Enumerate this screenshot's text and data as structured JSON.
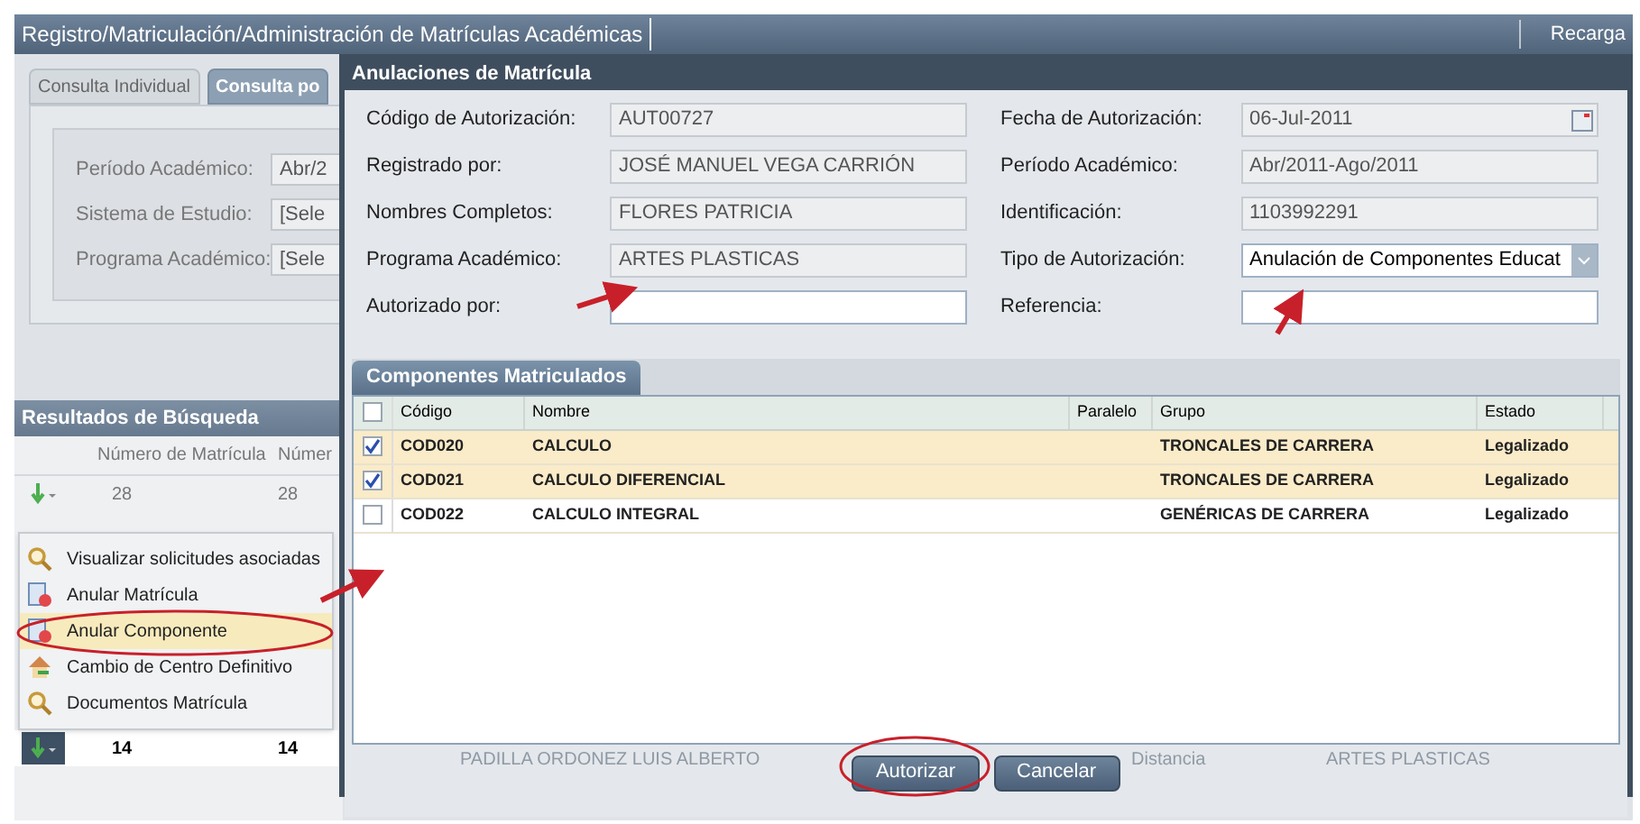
{
  "window": {
    "title": "Registro/Matriculación/Administración de Matrículas Académicas",
    "reload": "Recarga"
  },
  "tabs": [
    {
      "label": "Consulta Individual",
      "selected": false
    },
    {
      "label": "Consulta po",
      "selected": true
    }
  ],
  "filters": [
    {
      "label": "Período Académico:",
      "value": "Abr/2"
    },
    {
      "label": "Sistema de Estudio:",
      "value": "[Sele"
    },
    {
      "label": "Programa Académico:",
      "value": "[Sele"
    }
  ],
  "results": {
    "title": "Resultados de Búsqueda",
    "columns": [
      "Número de Matrícula",
      "Númer"
    ],
    "rows": [
      {
        "cells": [
          "28",
          "28"
        ],
        "selected": false
      },
      {
        "cells": [
          "14",
          "14"
        ],
        "selected": true
      }
    ]
  },
  "context_menu": [
    {
      "label": "Visualizar solicitudes asociadas",
      "kind": "magnifier",
      "selected": false
    },
    {
      "label": "Anular Matrícula",
      "kind": "document",
      "selected": false
    },
    {
      "label": "Anular Componente",
      "kind": "document",
      "selected": true
    },
    {
      "label": "Cambio de Centro Definitivo",
      "kind": "house",
      "selected": false
    },
    {
      "label": "Documentos Matrícula",
      "kind": "magnifier",
      "selected": false
    }
  ],
  "dialog": {
    "title": "Anulaciones de Matrícula",
    "fields_left": [
      {
        "label": "Código de Autorización:",
        "value": "AUT00727",
        "kind": "readonly"
      },
      {
        "label": "Registrado por:",
        "value": "JOSÉ MANUEL VEGA CARRIÓN",
        "kind": "readonly"
      },
      {
        "label": "Nombres Completos:",
        "value": "FLORES  PATRICIA",
        "kind": "readonly"
      },
      {
        "label": "Programa Académico:",
        "value": "ARTES PLASTICAS",
        "kind": "readonly"
      },
      {
        "label": "Autorizado por:",
        "kind": "input"
      }
    ],
    "fields_right": [
      {
        "label": "Fecha de Autorización:",
        "value": "06-Jul-2011",
        "kind": "date"
      },
      {
        "label": "Período Académico:",
        "value": "Abr/2011-Ago/2011",
        "kind": "readonly"
      },
      {
        "label": "Identificación:",
        "value": "1103992291",
        "kind": "readonly"
      },
      {
        "label": "Tipo de Autorización:",
        "value": "Anulación de Componentes Educat",
        "kind": "select"
      },
      {
        "label": "Referencia:",
        "kind": "input"
      }
    ],
    "table_tab": "Componentes Matriculados",
    "table": {
      "all_checked": false,
      "columns": [
        "Código",
        "Nombre",
        "Paralelo",
        "Grupo",
        "Estado"
      ],
      "rows": [
        {
          "checked": true,
          "cells": [
            "COD020",
            "CALCULO",
            "",
            "TRONCALES DE CARRERA",
            "Legalizado"
          ]
        },
        {
          "checked": true,
          "cells": [
            "COD021",
            "CALCULO DIFERENCIAL",
            "",
            "TRONCALES DE CARRERA",
            "Legalizado"
          ]
        },
        {
          "checked": false,
          "cells": [
            "COD022",
            "CALCULO INTEGRAL",
            "",
            "GENÉRICAS DE CARRERA",
            "Legalizado"
          ]
        }
      ]
    },
    "background_texts": [
      "PADILLA ORDONEZ LUIS ALBERTO",
      "Distancia",
      "ARTES PLASTICAS"
    ],
    "buttons": [
      "Autorizar",
      "Cancelar"
    ]
  }
}
